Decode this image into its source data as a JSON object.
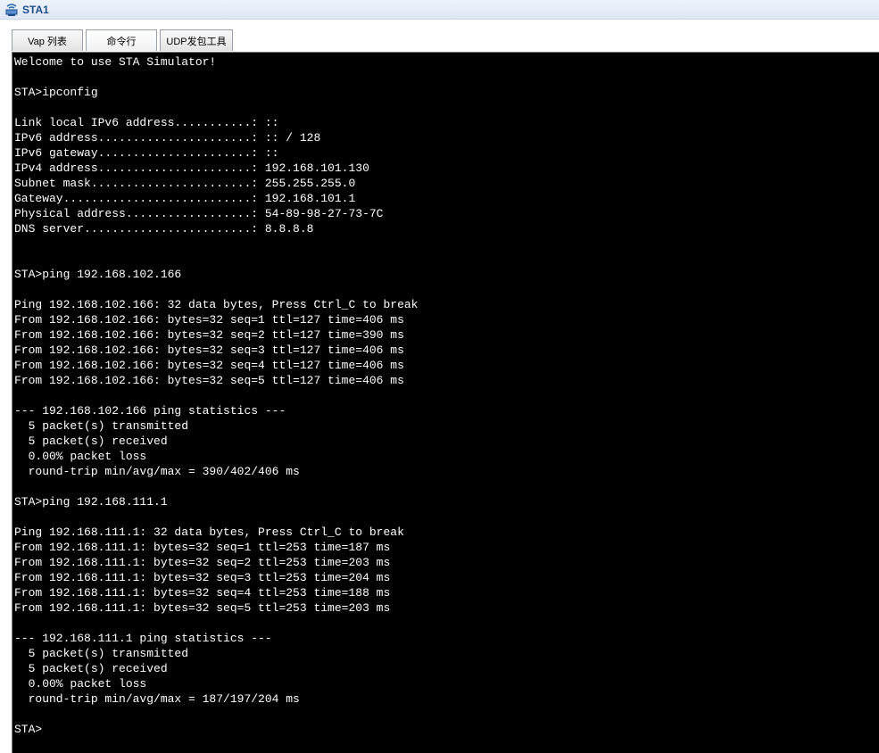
{
  "window": {
    "title": "STA1"
  },
  "tabs": [
    {
      "label": "Vap 列表"
    },
    {
      "label": "命令行"
    },
    {
      "label": "UDP发包工具"
    }
  ],
  "terminal": {
    "lines": [
      "Welcome to use STA Simulator!",
      "",
      "STA>ipconfig",
      "",
      "Link local IPv6 address...........: ::",
      "IPv6 address......................: :: / 128",
      "IPv6 gateway......................: ::",
      "IPv4 address......................: 192.168.101.130",
      "Subnet mask.......................: 255.255.255.0",
      "Gateway...........................: 192.168.101.1",
      "Physical address..................: 54-89-98-27-73-7C",
      "DNS server........................: 8.8.8.8",
      "",
      "",
      "STA>ping 192.168.102.166",
      "",
      "Ping 192.168.102.166: 32 data bytes, Press Ctrl_C to break",
      "From 192.168.102.166: bytes=32 seq=1 ttl=127 time=406 ms",
      "From 192.168.102.166: bytes=32 seq=2 ttl=127 time=390 ms",
      "From 192.168.102.166: bytes=32 seq=3 ttl=127 time=406 ms",
      "From 192.168.102.166: bytes=32 seq=4 ttl=127 time=406 ms",
      "From 192.168.102.166: bytes=32 seq=5 ttl=127 time=406 ms",
      "",
      "--- 192.168.102.166 ping statistics ---",
      "  5 packet(s) transmitted",
      "  5 packet(s) received",
      "  0.00% packet loss",
      "  round-trip min/avg/max = 390/402/406 ms",
      "",
      "STA>ping 192.168.111.1",
      "",
      "Ping 192.168.111.1: 32 data bytes, Press Ctrl_C to break",
      "From 192.168.111.1: bytes=32 seq=1 ttl=253 time=187 ms",
      "From 192.168.111.1: bytes=32 seq=2 ttl=253 time=203 ms",
      "From 192.168.111.1: bytes=32 seq=3 ttl=253 time=204 ms",
      "From 192.168.111.1: bytes=32 seq=4 ttl=253 time=188 ms",
      "From 192.168.111.1: bytes=32 seq=5 ttl=253 time=203 ms",
      "",
      "--- 192.168.111.1 ping statistics ---",
      "  5 packet(s) transmitted",
      "  5 packet(s) received",
      "  0.00% packet loss",
      "  round-trip min/avg/max = 187/197/204 ms",
      "",
      "STA>"
    ]
  }
}
